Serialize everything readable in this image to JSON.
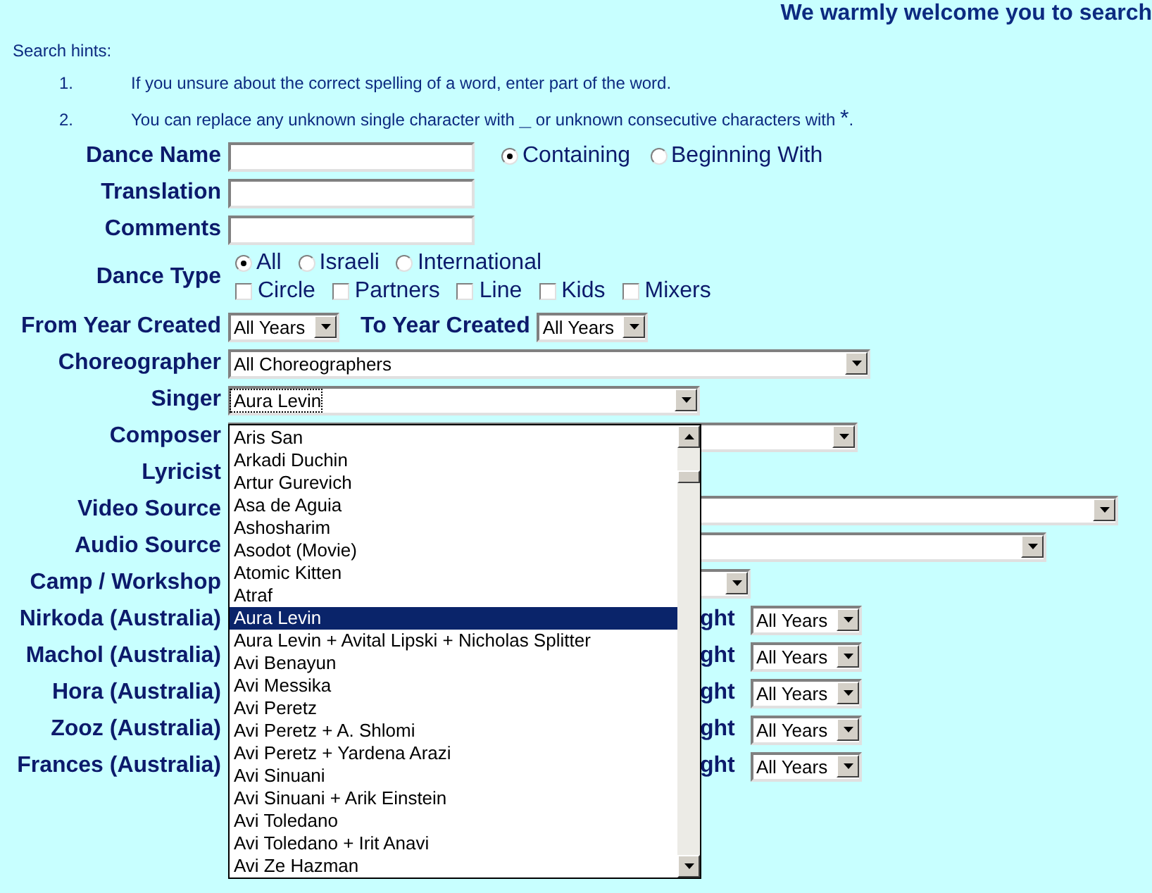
{
  "header": {
    "title": "We warmly welcome you to search"
  },
  "hints": {
    "title": "Search hints:",
    "items": [
      {
        "number": "1.",
        "text": "If you unsure about the correct spelling of a word, enter part of the word."
      },
      {
        "number": "2.",
        "text": "You can replace any unknown single character with",
        "symbol_1": "_",
        "middle": "or unknown consecutive characters with",
        "symbol_2": "*",
        "end": "."
      }
    ]
  },
  "form": [
    {
      "kind": "text",
      "label": "Dance Name",
      "match": [
        {
          "label": "Containing",
          "selected": true
        },
        {
          "label": "Beginning With",
          "selected": false
        }
      ]
    },
    {
      "kind": "text",
      "label": "Translation"
    },
    {
      "kind": "text",
      "label": "Comments"
    },
    {
      "kind": "dance_type",
      "label": "Dance Type",
      "types": [
        {
          "label": "All",
          "selected": true
        },
        {
          "label": "Israeli",
          "selected": false
        },
        {
          "label": "International",
          "selected": false
        }
      ],
      "styles": [
        {
          "label": "Circle",
          "checked": false
        },
        {
          "label": "Partners",
          "checked": false
        },
        {
          "label": "Line",
          "checked": false
        },
        {
          "label": "Kids",
          "checked": false
        },
        {
          "label": "Mixers",
          "checked": false
        }
      ]
    },
    {
      "kind": "year_range",
      "label": "From Year Created",
      "value": "All Years",
      "to_label": "To Year Created",
      "to_value": "All Years"
    },
    {
      "kind": "select",
      "label": "Choreographer",
      "value": "All Choreographers"
    },
    {
      "kind": "select",
      "label": "Singer",
      "value": "Aura Levin",
      "open": true
    },
    {
      "kind": "select",
      "label": "Composer"
    },
    {
      "kind": "hidden",
      "label": "Lyricist"
    },
    {
      "kind": "select",
      "label": "Video Source"
    },
    {
      "kind": "select",
      "label": "Audio Source"
    },
    {
      "kind": "select",
      "label": "Camp / Workshop"
    },
    {
      "kind": "australia",
      "label": "Nirkoda (Australia)",
      "column_3": "ght",
      "value": "All Years"
    },
    {
      "kind": "australia",
      "label": "Machol (Australia)",
      "column_3": "ght",
      "value": "All Years"
    },
    {
      "kind": "australia",
      "label": "Hora (Australia)",
      "column_3": "ght",
      "value": "All Years"
    },
    {
      "kind": "australia",
      "label": "Zooz (Australia)",
      "column_3": "ght",
      "value": "All Years"
    },
    {
      "kind": "australia",
      "label": "Frances (Australia)",
      "column_3": "ght",
      "value": "All Years"
    }
  ],
  "singer_list": [
    {
      "label": "Aris San",
      "selected": false
    },
    {
      "label": "Arkadi Duchin",
      "selected": false
    },
    {
      "label": "Artur Gurevich",
      "selected": false
    },
    {
      "label": "Asa de Aguia",
      "selected": false
    },
    {
      "label": "Ashosharim",
      "selected": false
    },
    {
      "label": "Asodot (Movie)",
      "selected": false
    },
    {
      "label": "Atomic Kitten",
      "selected": false
    },
    {
      "label": "Atraf",
      "selected": false
    },
    {
      "label": "Aura Levin",
      "selected": true
    },
    {
      "label": "Aura Levin + Avital Lipski + Nicholas Splitter",
      "selected": false
    },
    {
      "label": "Avi Benayun",
      "selected": false
    },
    {
      "label": "Avi Messika",
      "selected": false
    },
    {
      "label": "Avi Peretz",
      "selected": false
    },
    {
      "label": "Avi Peretz + A. Shlomi",
      "selected": false
    },
    {
      "label": "Avi Peretz + Yardena Arazi",
      "selected": false
    },
    {
      "label": "Avi Sinuani",
      "selected": false
    },
    {
      "label": "Avi Sinuani + Arik Einstein",
      "selected": false
    },
    {
      "label": "Avi Toledano",
      "selected": false
    },
    {
      "label": "Avi Toledano + Irit Anavi",
      "selected": false
    },
    {
      "label": "Avi Ze Hazman",
      "selected": false
    }
  ]
}
